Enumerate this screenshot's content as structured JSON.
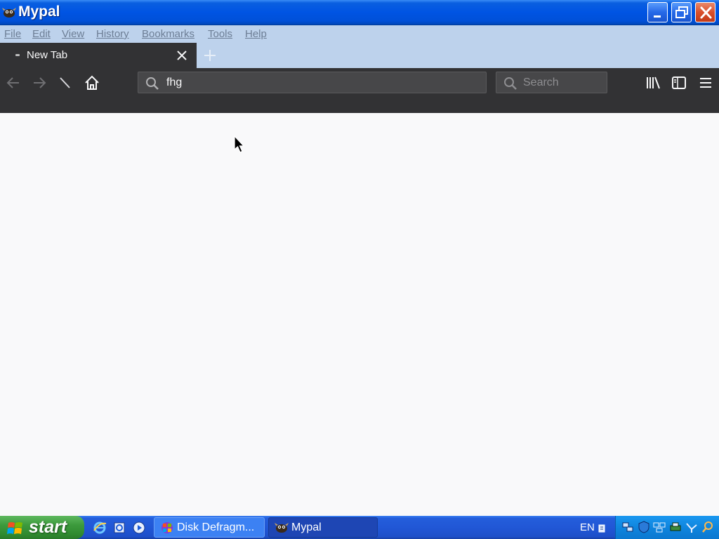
{
  "window": {
    "title": "Mypal",
    "controls": [
      "minimize",
      "restore",
      "close"
    ]
  },
  "menubar": {
    "items": [
      "File",
      "Edit",
      "View",
      "History",
      "Bookmarks",
      "Tools",
      "Help"
    ]
  },
  "tabs": [
    {
      "label": "New Tab",
      "active": true
    }
  ],
  "toolbar": {
    "url_value": "fhg",
    "search_placeholder": "Search",
    "icons": [
      "back-icon",
      "forward-icon",
      "reload-icon",
      "home-icon",
      "library-icon",
      "sidebar-icon",
      "menu-icon"
    ]
  },
  "taskbar": {
    "start_label": "start",
    "quick_launch": [
      "internet-explorer-icon",
      "outlook-express-icon",
      "media-player-icon"
    ],
    "tasks": [
      {
        "label": "Disk Defragm...",
        "icon": "defrag-icon"
      },
      {
        "label": "Mypal",
        "icon": "mypal-icon"
      }
    ],
    "language": "EN",
    "tray_icons": [
      "network-icon",
      "security-icon",
      "display-icon",
      "printer-icon",
      "connection-icon",
      "search-icon"
    ]
  },
  "colors": {
    "titlebar": "#0054e3",
    "menubar": "#bdd2ec",
    "toolbar": "#323234",
    "content": "#f9f9fa",
    "taskbar": "#245edb",
    "start": "#3c9a3c"
  }
}
